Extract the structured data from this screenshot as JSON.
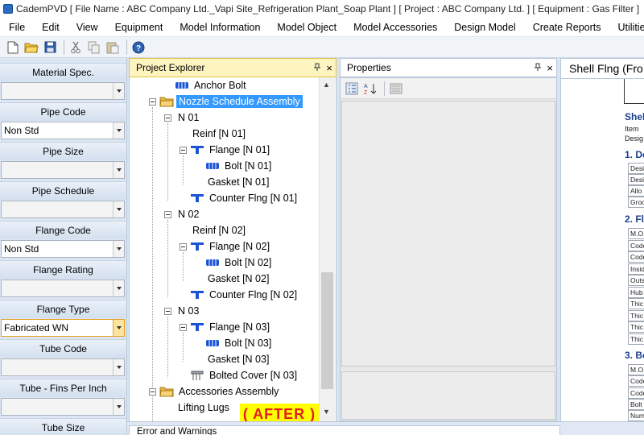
{
  "window": {
    "title": "CademPVD [ File Name : ABC Company Ltd._Vapi Site_Refrigeration Plant_Soap Plant ] [ Project : ABC Company Ltd. ] [ Equipment : Gas Filter ]"
  },
  "menu": [
    "File",
    "Edit",
    "View",
    "Equipment",
    "Model Information",
    "Model Object",
    "Model Accessories",
    "Design Model",
    "Create Reports",
    "Utilities",
    "He"
  ],
  "toolbar": {
    "icons": [
      "new-file-icon",
      "open-folder-icon",
      "save-icon",
      "cut-icon",
      "copy-icon",
      "paste-icon",
      "help-icon"
    ]
  },
  "left_panel": {
    "fields": [
      {
        "label": "Material Spec.",
        "value": ""
      },
      {
        "label": "Pipe Code",
        "value": "Non Std"
      },
      {
        "label": "Pipe Size",
        "value": ""
      },
      {
        "label": "Pipe Schedule",
        "value": ""
      },
      {
        "label": "Flange Code",
        "value": "Non Std"
      },
      {
        "label": "Flange Rating",
        "value": ""
      },
      {
        "label": "Flange Type",
        "value": "Fabricated WN"
      },
      {
        "label": "Tube Code",
        "value": ""
      },
      {
        "label": "Tube - Fins Per Inch",
        "value": ""
      },
      {
        "label": "Tube Size",
        "value": ""
      }
    ]
  },
  "project_explorer": {
    "title": "Project Explorer",
    "pin": "⬍",
    "close": "×",
    "items": [
      {
        "label": "Anchor Bolt",
        "icon": "bolt-icon"
      },
      {
        "label": "Nozzle Schedule Assembly",
        "icon": "folder-icon"
      },
      {
        "label": "N 01",
        "icon": ""
      },
      {
        "label": "Reinf [N 01]",
        "icon": ""
      },
      {
        "label": "Flange [N 01]",
        "icon": "flange-icon"
      },
      {
        "label": "Bolt [N 01]",
        "icon": "bolt-icon"
      },
      {
        "label": "Gasket [N 01]",
        "icon": ""
      },
      {
        "label": "Counter Flng [N 01]",
        "icon": "flange-icon"
      },
      {
        "label": "N 02",
        "icon": ""
      },
      {
        "label": "Reinf [N 02]",
        "icon": ""
      },
      {
        "label": "Flange [N 02]",
        "icon": "flange-icon"
      },
      {
        "label": "Bolt [N 02]",
        "icon": "bolt-icon"
      },
      {
        "label": "Gasket [N 02]",
        "icon": ""
      },
      {
        "label": "Counter Flng [N 02]",
        "icon": "flange-icon"
      },
      {
        "label": "N 03",
        "icon": ""
      },
      {
        "label": "Flange [N 03]",
        "icon": "flange-icon"
      },
      {
        "label": "Bolt [N 03]",
        "icon": "bolt-icon"
      },
      {
        "label": "Gasket [N 03]",
        "icon": ""
      },
      {
        "label": "Bolted Cover [N 03]",
        "icon": "cover-icon"
      },
      {
        "label": "Accessories Assembly",
        "icon": "folder-icon"
      },
      {
        "label": "Lifting Lugs",
        "icon": ""
      }
    ],
    "selected": "Nozzle Schedule Assembly",
    "badge": "( AFTER )"
  },
  "properties": {
    "title": "Properties",
    "pin": "⬍",
    "close": "×"
  },
  "report": {
    "tab_label": "Shell Flng (Fro",
    "heading": "Shel",
    "line1": "Item",
    "line2": "Desig",
    "section1": "1. De",
    "section1_cells": [
      "Desi",
      "Desi",
      "Allo",
      "Groo"
    ],
    "section2": "2. Fl",
    "section2_cells": [
      "M.O.",
      "Code",
      "Code",
      "Insid",
      "Outs",
      "Hub",
      "Thic",
      "Thic",
      "Thic",
      "Thic"
    ],
    "section3": "3. Bo",
    "section3_cells": [
      "M.O.",
      "Code",
      "Code",
      "Bolt",
      "Num"
    ]
  },
  "bottom": {
    "error_tab": "Error and Warnings"
  },
  "colors": {
    "selection": "#3399ff",
    "badge_bg": "#ffff00",
    "badge_text": "#e0201a",
    "active_header": "#fdf4bf",
    "report_heading": "#1c3f8c"
  }
}
